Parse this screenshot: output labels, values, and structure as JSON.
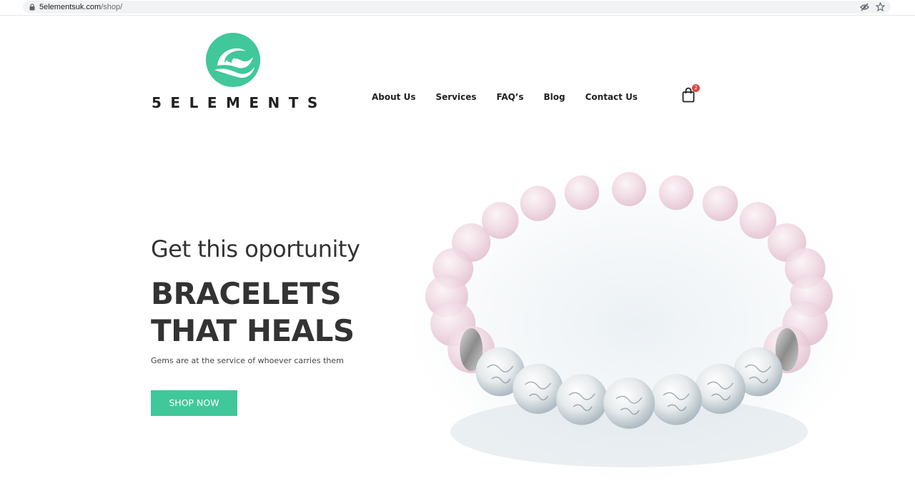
{
  "browser": {
    "url_domain": "5elementsuk.com",
    "url_path": "/shop/",
    "icons": [
      "lock-icon",
      "eye-off-icon",
      "star-icon"
    ]
  },
  "header": {
    "logo_text": "5ELEMENTS",
    "nav": [
      {
        "label": "About Us"
      },
      {
        "label": "Services"
      },
      {
        "label": "FAQ’s"
      },
      {
        "label": "Blog"
      },
      {
        "label": "Contact Us"
      }
    ],
    "cart_count": "2"
  },
  "hero": {
    "subtitle": "Get this oportunity",
    "title_line1": "BRACELETS",
    "title_line2": "THAT HEALS",
    "description": "Gems are at the service of whoever carries them",
    "cta_label": "SHOP NOW"
  },
  "colors": {
    "brand_green": "#40c89a",
    "badge_red": "#e04545",
    "text_dark": "#333333"
  }
}
